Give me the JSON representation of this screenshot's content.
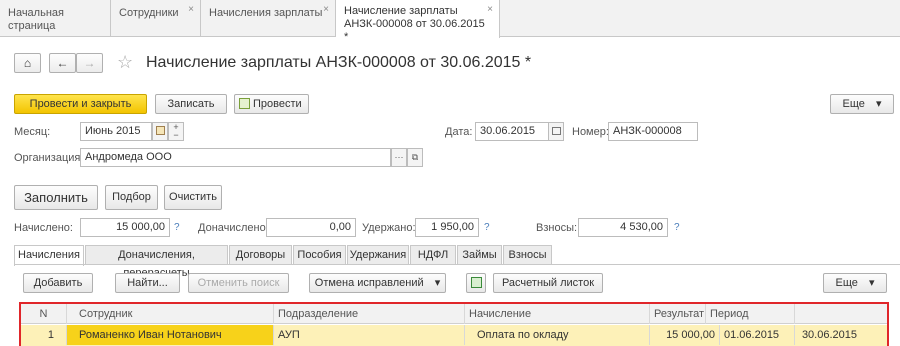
{
  "window_tabs": [
    {
      "label": "Начальная страница"
    },
    {
      "label": "Сотрудники",
      "close": "×"
    },
    {
      "label": "Начисления зарплаты",
      "close": "×"
    },
    {
      "label_line1": "Начисление зарплаты",
      "label_line2": "АНЗК-000008 от 30.06.2015 *",
      "close": "×"
    }
  ],
  "nav": {
    "home": "⌂",
    "back": "←",
    "forward": "→",
    "star": "☆"
  },
  "title": "Начисление зарплаты АНЗК-000008 от 30.06.2015 *",
  "toolbar": {
    "post_close": "Провести и закрыть",
    "save": "Записать",
    "post": "Провести",
    "more": "Еще",
    "more_arrow": "▾"
  },
  "form": {
    "month_label": "Месяц:",
    "month_value": "Июнь 2015",
    "date_label": "Дата:",
    "date_value": "30.06.2015",
    "number_label": "Номер:",
    "number_value": "АНЗК-000008",
    "org_label": "Организация:",
    "org_value": "Андромеда ООО"
  },
  "actions": {
    "fill": "Заполнить",
    "select": "Подбор",
    "clear": "Очистить"
  },
  "totals": {
    "accrued_label": "Начислено:",
    "accrued_value": "15 000,00",
    "additional_label": "Доначислено:",
    "additional_value": "0,00",
    "withheld_label": "Удержано:",
    "withheld_value": "1 950,00",
    "contrib_label": "Взносы:",
    "contrib_value": "4 530,00",
    "help": "?"
  },
  "doc_tabs": [
    {
      "label": "Начисления"
    },
    {
      "label": "Доначисления, перерасчеты"
    },
    {
      "label": "Договоры"
    },
    {
      "label": "Пособия"
    },
    {
      "label": "Удержания"
    },
    {
      "label": "НДФЛ"
    },
    {
      "label": "Займы"
    },
    {
      "label": "Взносы"
    }
  ],
  "table_toolbar": {
    "add": "Добавить",
    "find": "Найти...",
    "cancel_search": "Отменить поиск",
    "cancel_corrections": "Отмена исправлений",
    "dropdown_arrow": "▾",
    "payslip": "Расчетный листок",
    "more": "Еще"
  },
  "table": {
    "headers": [
      "N",
      "Сотрудник",
      "Подразделение",
      "Начисление",
      "Результат",
      "Период",
      ""
    ],
    "rows": [
      [
        "1",
        "Романенко Иван Нотанович",
        "АУП",
        "Оплата по окладу",
        "15 000,00",
        "01.06.2015",
        "30.06.2015"
      ]
    ]
  },
  "colors": {
    "accent_yellow": "#f3c400",
    "selection": "#fdf1b8",
    "highlight_border": "#e0262a"
  }
}
